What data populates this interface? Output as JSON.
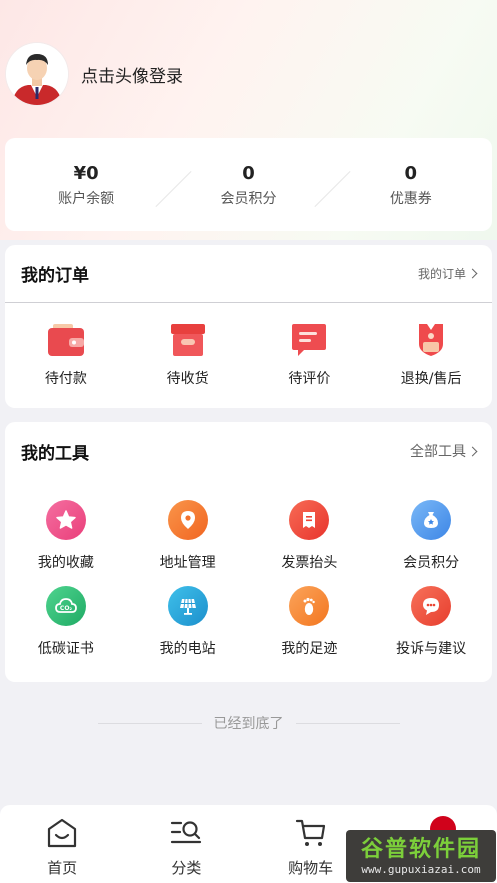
{
  "profile": {
    "login_text": "点击头像登录"
  },
  "stats": [
    {
      "value": "¥0",
      "label": "账户余额"
    },
    {
      "value": "0",
      "label": "会员积分"
    },
    {
      "value": "0",
      "label": "优惠券"
    }
  ],
  "orders": {
    "title": "我的订单",
    "link": "我的订单",
    "items": [
      {
        "label": "待付款",
        "icon": "wallet-icon"
      },
      {
        "label": "待收货",
        "icon": "box-icon"
      },
      {
        "label": "待评价",
        "icon": "comment-icon"
      },
      {
        "label": "退换/售后",
        "icon": "after-sale-icon"
      }
    ]
  },
  "tools": {
    "title": "我的工具",
    "link": "全部工具",
    "items": [
      {
        "label": "我的收藏",
        "icon": "star-icon",
        "color": "#f0508a"
      },
      {
        "label": "地址管理",
        "icon": "location-pin-icon",
        "color": "#f5772a"
      },
      {
        "label": "发票抬头",
        "icon": "invoice-icon",
        "color": "#ee4a3a"
      },
      {
        "label": "会员积分",
        "icon": "points-bag-icon",
        "color": "#4d9cf0"
      },
      {
        "label": "低碳证书",
        "icon": "co2-icon",
        "color": "#2fc07a"
      },
      {
        "label": "我的电站",
        "icon": "solar-panel-icon",
        "color": "#29a7d8"
      },
      {
        "label": "我的足迹",
        "icon": "footprint-icon",
        "color": "#f68a2a"
      },
      {
        "label": "投诉与建议",
        "icon": "chat-icon",
        "color": "#ee4a3a"
      }
    ]
  },
  "footer_note": "已经到底了",
  "tabbar": [
    {
      "label": "首页",
      "icon": "home-icon"
    },
    {
      "label": "分类",
      "icon": "category-icon"
    },
    {
      "label": "购物车",
      "icon": "cart-icon"
    },
    {
      "label": "",
      "icon": "profile-icon"
    }
  ],
  "watermark": {
    "main": "谷普软件园",
    "sub": "www.gupuxiazai.com"
  }
}
